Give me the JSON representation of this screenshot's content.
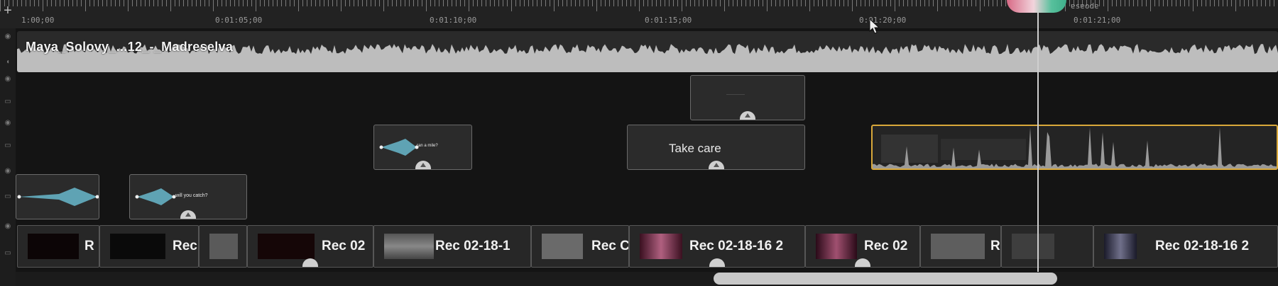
{
  "ruler": {
    "add_label": "+",
    "timecodes": [
      "1:00;00",
      "0:01:05;00",
      "0:01:10;00",
      "0:01:15;00",
      "0:01:20;00",
      "0:01:21;00"
    ],
    "marker_label": "ɐsɐodɐ"
  },
  "audio_track": {
    "name": "Maya_Solovy_...12_-_Madreselva"
  },
  "title_clips": {
    "top": {
      "label": "·············"
    },
    "callout_1": {
      "label": "ran a mile?"
    },
    "take_care": {
      "label": "Take care"
    },
    "callout_2": {
      "label": "will you catch?"
    }
  },
  "video_clips": [
    {
      "label": "R"
    },
    {
      "label": "Rec"
    },
    {
      "label": ""
    },
    {
      "label": "Rec 02"
    },
    {
      "label": "Rec 02-18-1"
    },
    {
      "label": "Rec C"
    },
    {
      "label": "Rec 02-18-16 2"
    },
    {
      "label": "Rec 02"
    },
    {
      "label": "R"
    },
    {
      "label": ""
    },
    {
      "label": "Rec 02-18-16 2"
    }
  ],
  "colors": {
    "selected_border": "#d9a83a",
    "playhead": "#cfcfcf",
    "waveform": "#bdbdbd",
    "arrow": "#5fa3b4"
  },
  "icons": [
    "plus-icon",
    "eye-icon",
    "lock-icon",
    "speaker-icon",
    "arrow-pointer-icon"
  ]
}
